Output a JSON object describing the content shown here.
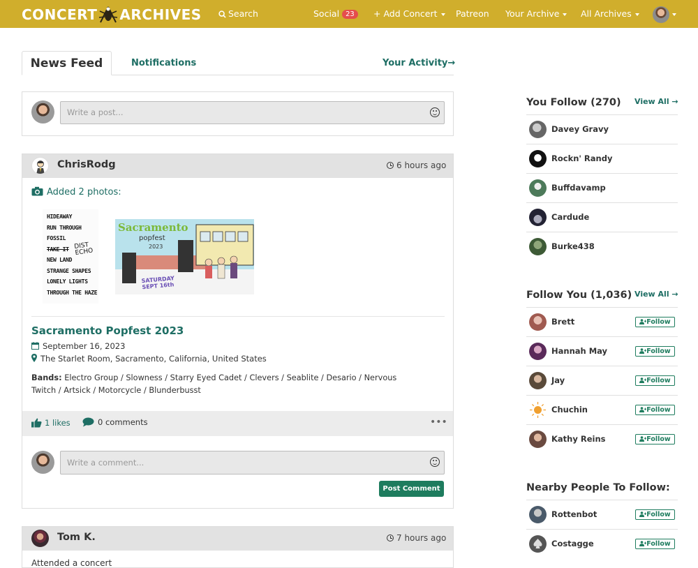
{
  "nav": {
    "logo_left": "CONCERT",
    "logo_right": "ARCHIVES",
    "search": "Search",
    "social": "Social",
    "social_count": "23",
    "add_concert": "+ Add Concert",
    "patreon": "Patreon",
    "your_archive": "Your Archive",
    "all_archives": "All Archives"
  },
  "tabs": {
    "news_feed": "News Feed",
    "notifications": "Notifications",
    "your_activity": "Your Activity→"
  },
  "composer": {
    "placeholder": "Write a post..."
  },
  "posts": [
    {
      "user": "ChrisRodg",
      "time": "6 hours ago",
      "action": "Added 2 photos:",
      "setlist_lines": [
        "HIDEAWAY",
        "RUN THROUGH",
        "FOSSIL",
        "TAKE IT",
        "NEW LAND",
        "STRANGE SHAPES",
        "LONELY LIGHTS",
        "THROUGH THE HAZE"
      ],
      "setlist_scribble": "DIST ECHO",
      "poster_title": "Sacramento",
      "poster_subtitle": "popfest",
      "poster_year": "2023",
      "poster_date": "SATURDAY SEPT 16th",
      "event_title": "Sacramento Popfest 2023",
      "date": "September 16, 2023",
      "venue": "The Starlet Room, Sacramento, California, United States",
      "bands_label": "Bands:",
      "bands": "Electro Group / Slowness / Starry Eyed Cadet / Clevers / Seablite / Desario / Nervous Twitch / Artsick / Motorcycle / Blunderbusst",
      "likes": "1 likes",
      "comments": "0 comments",
      "comment_placeholder": "Write a comment...",
      "post_comment": "Post Comment"
    },
    {
      "user": "Tom K.",
      "time": "7 hours ago",
      "action": "Attended a concert"
    }
  ],
  "sidebar": {
    "you_follow": {
      "heading": "You Follow (270)",
      "view_all": "View All →",
      "people": [
        "Davey Gravy",
        "Rockn' Randy",
        "Buffdavamp",
        "Cardude",
        "Burke438"
      ]
    },
    "follow_you": {
      "heading": "Follow You (1,036)",
      "view_all": "View All →",
      "people": [
        "Brett",
        "Hannah May",
        "Jay",
        "Chuchin",
        "Kathy Reins"
      ]
    },
    "nearby": {
      "heading": "Nearby People To Follow:",
      "people": [
        "Rottenbot",
        "Costagge"
      ]
    },
    "follow_label": "Follow"
  },
  "colors": {
    "topbar": "#d0ae2c",
    "accent": "#1e6e64",
    "button": "#1e7c5e",
    "badge": "#e54d4d"
  },
  "icons": [
    "search-icon",
    "camera-icon",
    "calendar-icon",
    "map-marker-icon",
    "thumbs-up-icon",
    "comment-icon",
    "clock-icon",
    "smiley-icon",
    "user-plus-icon"
  ]
}
